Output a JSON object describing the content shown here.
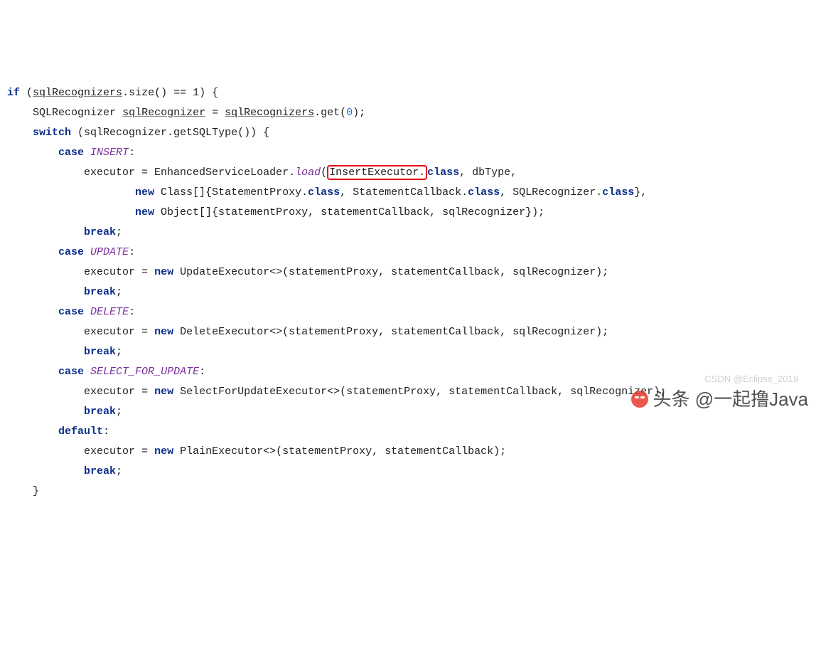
{
  "code": {
    "l1": {
      "kw_if": "if",
      "p": " (",
      "var": "sqlRecognizers",
      "rest": ".size() == 1) {"
    },
    "l2": {
      "indent": "    ",
      "type": "SQLRecognizer",
      "sp": " ",
      "var": "sqlRecognizer",
      "eq": " = ",
      "src": "sqlRecognizers",
      "call": ".get(",
      "num": "0",
      "end": ");"
    },
    "l3": {
      "indent": "    ",
      "kw": "switch",
      "rest": " (sqlRecognizer.getSQLType()) {"
    },
    "l4": {
      "indent": "        ",
      "kw": "case",
      "sp": " ",
      "label": "INSERT",
      "colon": ":"
    },
    "l5": {
      "indent": "            ",
      "lead": "executor = EnhancedServiceLoader.",
      "load": "load",
      "pre": "(",
      "boxed": "InsertExecutor.",
      "after": "class",
      "rest": ", dbType,"
    },
    "l6": {
      "indent": "                    ",
      "kw": "new",
      "rest1": " Class[]{StatementProxy.",
      "c1": "class",
      "rest2": ", StatementCallback.",
      "c2": "class",
      "rest3": ", SQLRecognizer.",
      "c3": "class",
      "rest4": "},"
    },
    "l7": {
      "indent": "                    ",
      "kw": "new",
      "rest": " Object[]{statementProxy, statementCallback, sqlRecognizer});"
    },
    "l8": {
      "indent": "            ",
      "kw": "break",
      "semi": ";"
    },
    "l9": {
      "indent": "        ",
      "kw": "case",
      "sp": " ",
      "label": "UPDATE",
      "colon": ":"
    },
    "l10": {
      "indent": "            ",
      "lead": "executor = ",
      "kw": "new",
      "rest": " UpdateExecutor<>(statementProxy, statementCallback, sqlRecognizer);"
    },
    "l11": {
      "indent": "            ",
      "kw": "break",
      "semi": ";"
    },
    "l12": {
      "indent": "        ",
      "kw": "case",
      "sp": " ",
      "label": "DELETE",
      "colon": ":"
    },
    "l13": {
      "indent": "            ",
      "lead": "executor = ",
      "kw": "new",
      "rest": " DeleteExecutor<>(statementProxy, statementCallback, sqlRecognizer);"
    },
    "l14": {
      "indent": "            ",
      "kw": "break",
      "semi": ";"
    },
    "l15": {
      "indent": "        ",
      "kw": "case",
      "sp": " ",
      "label": "SELECT_FOR_UPDATE",
      "colon": ":"
    },
    "l16": {
      "indent": "            ",
      "lead": "executor = ",
      "kw": "new",
      "rest": " SelectForUpdateExecutor<>(statementProxy, statementCallback, sqlRecognizer);"
    },
    "l17": {
      "indent": "            ",
      "kw": "break",
      "semi": ";"
    },
    "l18": {
      "indent": "        ",
      "kw": "default",
      "colon": ":"
    },
    "l19": {
      "indent": "            ",
      "lead": "executor = ",
      "kw": "new",
      "rest": " PlainExecutor<>(statementProxy, statementCallback);"
    },
    "l20": {
      "indent": "            ",
      "kw": "break",
      "semi": ";"
    },
    "l21": {
      "indent": "    ",
      "brace": "}"
    }
  },
  "watermarks": {
    "wm1": "头条 @一起撸Java",
    "wm2": "CSDN @Eclipse_2019"
  }
}
